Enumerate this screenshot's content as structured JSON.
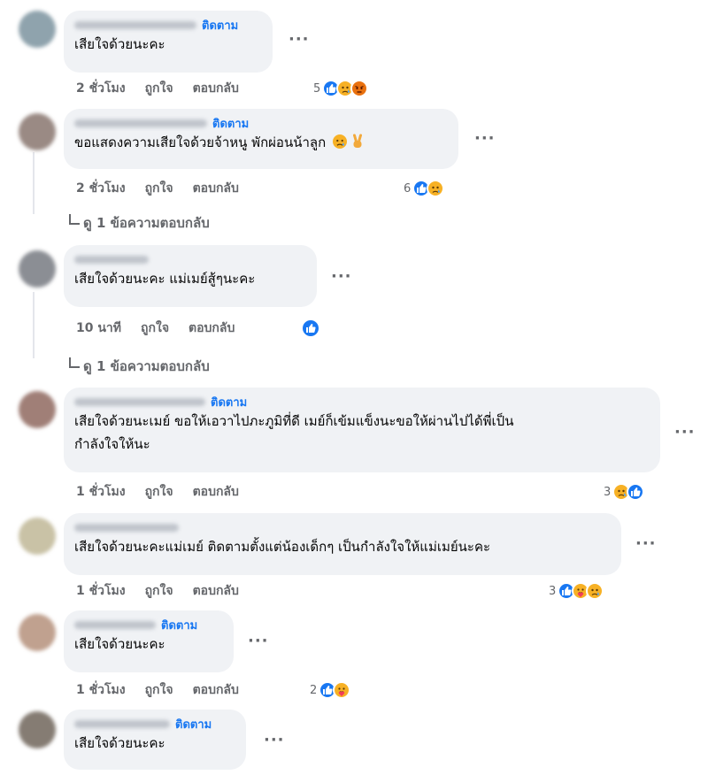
{
  "comments": [
    {
      "follow": "ติดตาม",
      "text": "เสียใจด้วยนะคะ",
      "time": "2 ชั่วโมง",
      "like": "ถูกใจ",
      "reply": "ตอบกลับ",
      "count": "5",
      "reactions": [
        "like-icon",
        "sad-icon",
        "angry-icon"
      ]
    },
    {
      "follow": "ติดตาม",
      "text": "ขอแสดงความเสียใจด้วยจ้าหนู พักผ่อนน้าลูก",
      "inline_emoji": [
        "sad-face-emoji",
        "victory-hand-emoji"
      ],
      "time": "2 ชั่วโมง",
      "like": "ถูกใจ",
      "reply": "ตอบกลับ",
      "count": "6",
      "reactions": [
        "like-icon",
        "sad-icon"
      ],
      "view_replies": "ดู 1 ข้อความตอบกลับ"
    },
    {
      "text": "เสียใจด้วยนะคะ แม่เมย์สู้ๆนะคะ",
      "time": "10 นาที",
      "like": "ถูกใจ",
      "reply": "ตอบกลับ",
      "reactions": [
        "like-icon"
      ],
      "view_replies": "ดู 1 ข้อความตอบกลับ"
    },
    {
      "follow": "ติดตาม",
      "text_line1": "เสียใจด้วยนะเมย์ ขอให้เอวาไปภะภูมิที่ดี เมย์ก็เข้มแข็งนะขอให้ผ่านไปได้พี่เป็น",
      "text_line2": "กำลังใจให้นะ",
      "time": "1 ชั่วโมง",
      "like": "ถูกใจ",
      "reply": "ตอบกลับ",
      "count": "3",
      "reactions": [
        "sad-icon",
        "like-icon"
      ]
    },
    {
      "text": "เสียใจด้วยนะคะแม่เมย์ ติดตามตั้งแต่น้องเด็กๆ เป็นกำลังใจให้แม่เมย์นะคะ",
      "time": "1 ชั่วโมง",
      "like": "ถูกใจ",
      "reply": "ตอบกลับ",
      "count": "3",
      "reactions": [
        "like-icon",
        "care-icon",
        "sad-icon"
      ]
    },
    {
      "follow": "ติดตาม",
      "text": "เสียใจด้วยนะคะ",
      "time": "1 ชั่วโมง",
      "like": "ถูกใจ",
      "reply": "ตอบกลับ",
      "count": "2",
      "reactions": [
        "like-icon",
        "care-icon"
      ]
    },
    {
      "follow": "ติดตาม",
      "text": "เสียใจด้วยนะคะ"
    }
  ],
  "more_label": "···",
  "colors": {
    "link": "#1877f2",
    "bubble": "#f0f2f5",
    "meta": "#65676b",
    "like": "#1877f2",
    "sad": "#f7b125",
    "angry": "#e9710f"
  }
}
